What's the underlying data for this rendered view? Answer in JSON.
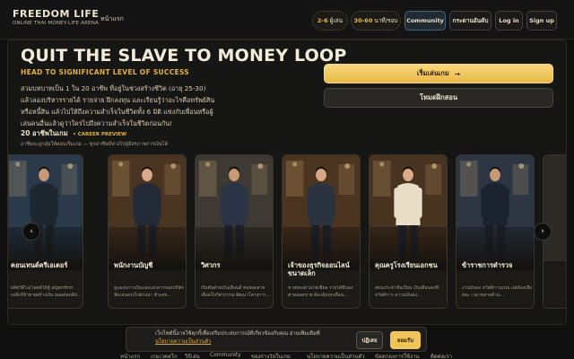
{
  "header": {
    "brand_title": "FREEDOM LIFE",
    "brand_subtitle": "ONLINE THAI MONEY-LIFE ARENA",
    "nav_home": "หน้าแรก",
    "players_count": "2-6",
    "players_label": "ผู้เล่น",
    "duration_count": "30-60",
    "duration_label": "นาที/รอบ",
    "community_label": "Community",
    "leaderboard_label": "กระดานอันดับ",
    "login_label": "Log in",
    "signup_label": "Sign up"
  },
  "hero": {
    "title": "QUIT THE SLAVE TO MONEY LOOP",
    "subtitle": "HEAD TO SIGNIFICANT LEVEL OF SUCCESS",
    "description": "สวมบทบาทเป็น 1 ใน 20 อาชีพ ที่อยู่ในช่วงสร้างชีวิต (อายุ 25-30) แล้วลองบริหารรายได้ รายจ่าย ฝึกลงทุน และเรียนรู้ว่าอะไรคือทรัพย์สินหรือหนี้สิน แล้วไปให้ถึงความสำเร็จในชีวิตทั้ง 6 มิติ แข่งกับเพื่อนหรือผู้เล่นคนอื่นแล้วดูว่าใครไปถึงความสำเร็จในชีวิตก่อนกัน!",
    "career_heading": "20 อาชีพในเกม",
    "career_tag": "• CAREER PREVIEW",
    "career_note": "อาชีพจะถูกสุ่มให้ตอนเริ่มเกม — ทุกอาชีพมีทางไปสู่อิสรภาพการเงินได้",
    "cta_start": "เริ่มเล่นเกม",
    "cta_start_arrow": "→",
    "cta_practice": "โหมดฝึกสอน"
  },
  "carousel": {
    "prev_icon": "‹",
    "next_icon": "›",
    "cards": [
      {
        "title": "คอนเทนต์ครีเอเตอร์",
        "desc": "ผลิตวิดีโอ/โพสต์ให้สู้ algorithm เคลียร์ท้าทายสร้างเงิน ยอดต่อคลิป…",
        "color": "#2a3a4a",
        "suit": "#1e2630",
        "skin": "#c79877"
      },
      {
        "title": "พนักงานบัญชี",
        "desc": "ดูแลงบการเงินและเอกสารของบริษัท ชัดเจนตรงไปตรงมา ตัวเลข…",
        "color": "#4a3522",
        "suit": "#232a38",
        "skin": "#d9ab88"
      },
      {
        "title": "วิศวกร",
        "desc": "เริ่มต้นด้วยเงินเดือนดี ต่อยอดสายเลือดในวิศวกรรม พัฒนาโครงการ…",
        "color": "#3e3a33",
        "suit": "#2a3444",
        "skin": "#c99a78"
      },
      {
        "title": "เจ้าของธุรกิจออนไลน์ขนาดเล็ก",
        "desc": "ขายของผ่านโซเชียล รายได้ขึ้นลงตามยอดขาย ต้องลุ้นทุกเดือน…",
        "color": "#4b3420",
        "suit": "#2b3340",
        "skin": "#d6a885"
      },
      {
        "title": "คุณครูโรงเรียนเอกชน",
        "desc": "สอนประจำชั้นเรียน เงินเดือนคงที่ สวัสดิการ ความมั่นคง…",
        "color": "#473320",
        "suit": "#e8ddc6",
        "skin": "#d9ab88"
      },
      {
        "title": "ข้าราชการตำรวจ",
        "desc": "งานมั่นคง สวัสดิการแน่น แต่ต้องเสียสละ เวลาหลายด้าน…",
        "color": "#2e3644",
        "suit": "#1c2330",
        "skin": "#c79877"
      }
    ]
  },
  "cookie": {
    "text": "เว็บไซต์นี้อาจใช้คุกกี้เพื่อเสริมประสบการณ์ที่เกี่ยวข้องกับคุณ อ่านเพิ่มเติมที่",
    "link": "นโยบายความเป็นส่วนตัว",
    "decline": "ปฏิเสธ",
    "accept": "ยอมรับ"
  },
  "footer": {
    "links": [
      "หน้าแรก",
      "เกมเวคสโก",
      "วิธีเล่น",
      "Community",
      "ของรางวัลในเกม",
      "นโยบายความเป็นส่วนตัว",
      "ข้อตกลงการใช้งาน",
      "ติดต่อเรา"
    ]
  }
}
